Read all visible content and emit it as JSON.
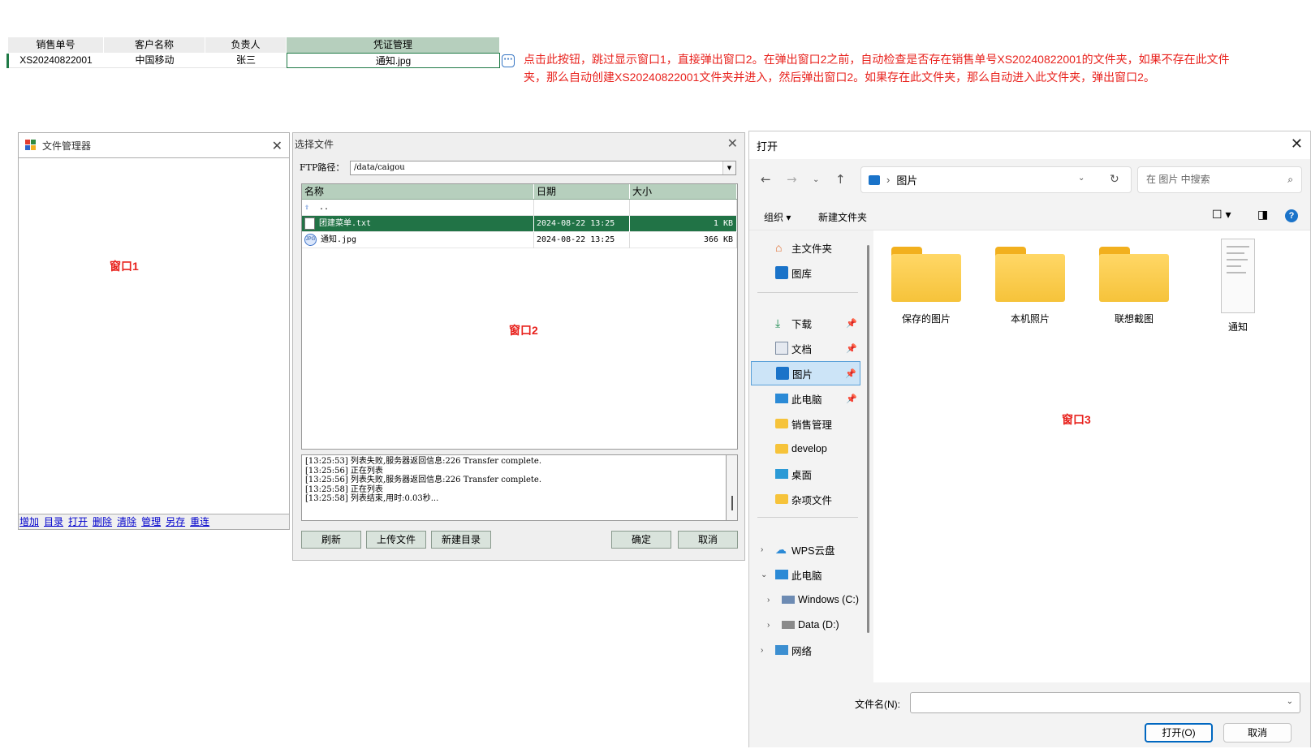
{
  "grid": {
    "headers": [
      "销售单号",
      "客户名称",
      "负责人",
      "凭证管理"
    ],
    "row": [
      "XS20240822001",
      "中国移动",
      "张三",
      "通知.jpg"
    ],
    "button_glyph": "···"
  },
  "annotation": "点击此按钮，跳过显示窗口1，直接弹出窗口2。在弹出窗口2之前，自动检查是否存在销售单号XS20240822001的文件夹，如果不存在此文件夹，那么自动创建XS20240822001文件夹并进入，然后弹出窗口2。如果存在此文件夹，那么自动进入此文件夹，弹出窗口2。",
  "window1": {
    "title": "文件管理器",
    "label": "窗口1",
    "links": [
      "增加",
      "目录",
      "打开",
      "删除",
      "清除",
      "管理",
      "另存",
      "重连"
    ]
  },
  "window2": {
    "title": "选择文件",
    "label": "窗口2",
    "ftp_label": "FTP路径：",
    "ftp_path": "/data/caigou",
    "columns": [
      "名称",
      "日期",
      "大小"
    ],
    "files": [
      {
        "name": "..",
        "date": "",
        "size": "",
        "icon": "up-arrow-icon"
      },
      {
        "name": "团建菜单.txt",
        "date": "2024-08-22 13:25",
        "size": "1 KB",
        "icon": "text-file-icon"
      },
      {
        "name": "通知.jpg",
        "date": "2024-08-22 13:25",
        "size": "366 KB",
        "icon": "jpg-file-icon"
      }
    ],
    "log": "[13:25:53] 列表失败,服务器返回信息:226 Transfer complete.\n[13:25:56] 正在列表\n[13:25:56] 列表失败,服务器返回信息:226 Transfer complete.\n[13:25:58] 正在列表\n[13:25:58] 列表结束,用时:0.03秒...",
    "buttons": {
      "refresh": "刷新",
      "upload": "上传文件",
      "new_dir": "新建目录",
      "ok": "确定",
      "cancel": "取消"
    }
  },
  "window3": {
    "title": "打开",
    "label": "窗口3",
    "address": "图片",
    "search_placeholder": "在 图片 中搜索",
    "organize": "组织 ▾",
    "new_folder": "新建文件夹",
    "nav": {
      "home": "主文件夹",
      "gallery": "图库",
      "downloads": "下载",
      "documents": "文档",
      "pictures": "图片",
      "this_pc_pinned": "此电脑",
      "sales_mgmt": "销售管理",
      "develop": "develop",
      "desktop": "桌面",
      "misc": "杂项文件",
      "wps": "WPS云盘",
      "this_pc": "此电脑",
      "drive_c": "Windows (C:)",
      "drive_d": "Data (D:)",
      "network": "网络"
    },
    "items": [
      "保存的图片",
      "本机照片",
      "联想截图",
      "通知"
    ],
    "filename_label": "文件名(N):",
    "open_button": "打开(O)",
    "cancel_button": "取消"
  },
  "colors": {
    "accent_green": "#217346",
    "header_green": "#b6cfbd",
    "annotation_red": "#e8221d",
    "win_blue": "#0067c0"
  }
}
